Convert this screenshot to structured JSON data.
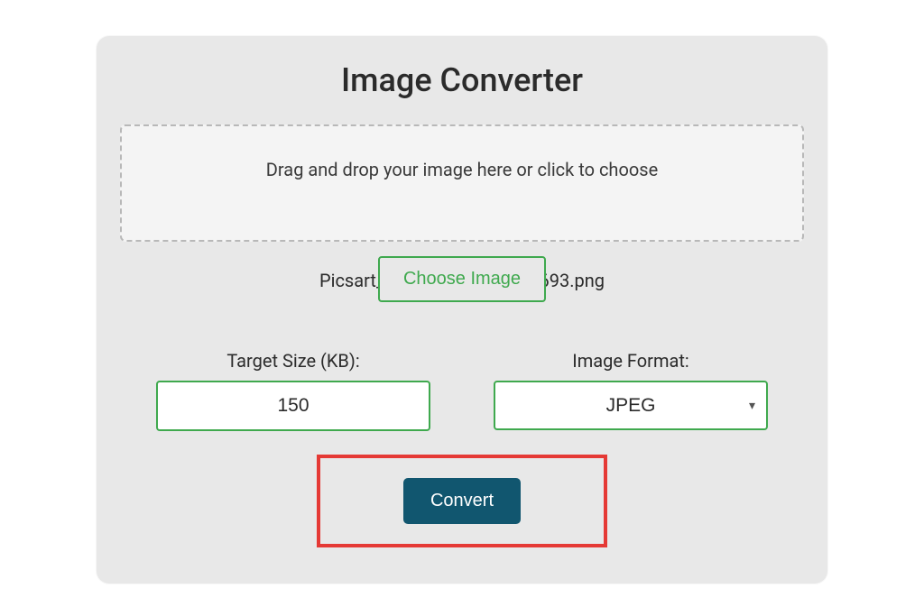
{
  "title": "Image Converter",
  "dropzone": {
    "text": "Drag and drop your image here or click to choose"
  },
  "choose_button_label": "Choose Image",
  "selected_filename": "Picsart_24-07-15_17-18-11-693.png",
  "target_size": {
    "label": "Target Size (KB):",
    "value": "150"
  },
  "image_format": {
    "label": "Image Format:",
    "value": "JPEG"
  },
  "convert_button_label": "Convert",
  "colors": {
    "accent_green": "#3fa94e",
    "btn_blue": "#11566f",
    "highlight_red": "#e53935"
  }
}
